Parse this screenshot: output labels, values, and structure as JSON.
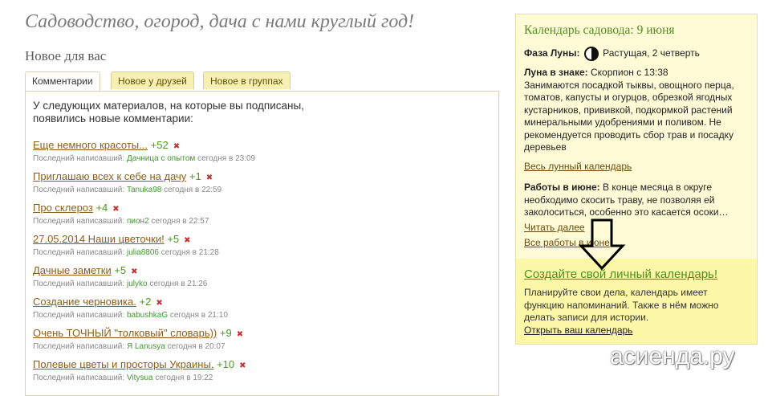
{
  "site": {
    "title": "Садоводство, огород, дача с нами круглый год!"
  },
  "section": {
    "title": "Новое для вас"
  },
  "tabs": [
    {
      "label": "Комментарии",
      "active": true
    },
    {
      "label": "Новое у друзей",
      "active": false
    },
    {
      "label": "Новое в группах",
      "active": false
    }
  ],
  "intro": "У следующих материалов, на которые вы подписаны, появились новые комментарии:",
  "last_writer_label": "Последний написавший:",
  "delete_glyph": "✖",
  "comments": [
    {
      "title": "Еще немного красоты...",
      "count": "+52",
      "user": "Дачница с опытом",
      "time": "сегодня в 23:09"
    },
    {
      "title": "Приглашаю всех к себе на дачу",
      "count": "+1",
      "user": "Tanuka98",
      "time": "сегодня в 22:59"
    },
    {
      "title": "Про склероз",
      "count": "+4",
      "user": "пион2",
      "time": "сегодня в 22:57"
    },
    {
      "title": "27.05.2014 Наши цветочки!",
      "count": "+5",
      "user": "julia8806",
      "time": "сегодня в 21:28"
    },
    {
      "title": "Дачные заметки",
      "count": "+5",
      "user": "julyko",
      "time": "сегодня в 21:26"
    },
    {
      "title": "Создание черновика.",
      "count": "+2",
      "user": "babushkaG",
      "time": "сегодня в 21:10"
    },
    {
      "title": "Очень ТОЧНЫЙ \"толковый\" словарь))",
      "count": "+9",
      "user": "Я Lanusya",
      "time": "сегодня в 20:07"
    },
    {
      "title": "Полевые цветы и просторы Украины.",
      "count": "+10",
      "user": "Vitysua",
      "time": "сегодня в 19:22"
    }
  ],
  "sidebar": {
    "title": "Календарь садовода: 9 июня",
    "moon_phase_label": "Фаза Луны:",
    "moon_phase_value": "Растущая, 2 четверть",
    "moon_sign_label": "Луна в знаке:",
    "moon_sign_value": "Скорпион с 13:38",
    "moon_text": "Занимаются посадкой тыквы, овощного перца, томатов, капусты и огурцов, обрезкой ягодных кустарников, прививкой, подкормкой растений минеральными удобрениями и поливом. Не рекомендуется проводить сбор трав и посадку деревьев",
    "lunar_calendar_link": "Весь лунный календарь",
    "work_label": "Работы в июне:",
    "work_text": "В конце месяца в округе необходимо скосить траву, не позволяя ей заколоситься, особенно это касается осоки…",
    "read_more_link": "Читать далее",
    "all_works_link": "Все работы в июне",
    "promo_title": "Создайте свой личный календарь!",
    "promo_text": "Планируйте свои дела, календарь имеет функцию напоминаний. Также в нём можно делать записи для истории.",
    "promo_link": "Открыть ваш календарь"
  },
  "watermark": "асиенда.ру",
  "colors": {
    "link": "#8c5e1c",
    "count": "#4a9a1e",
    "sidebar_bg": "#fffbd7",
    "promo_bg": "#fdf7a8",
    "accent_green": "#4e8f1f"
  }
}
